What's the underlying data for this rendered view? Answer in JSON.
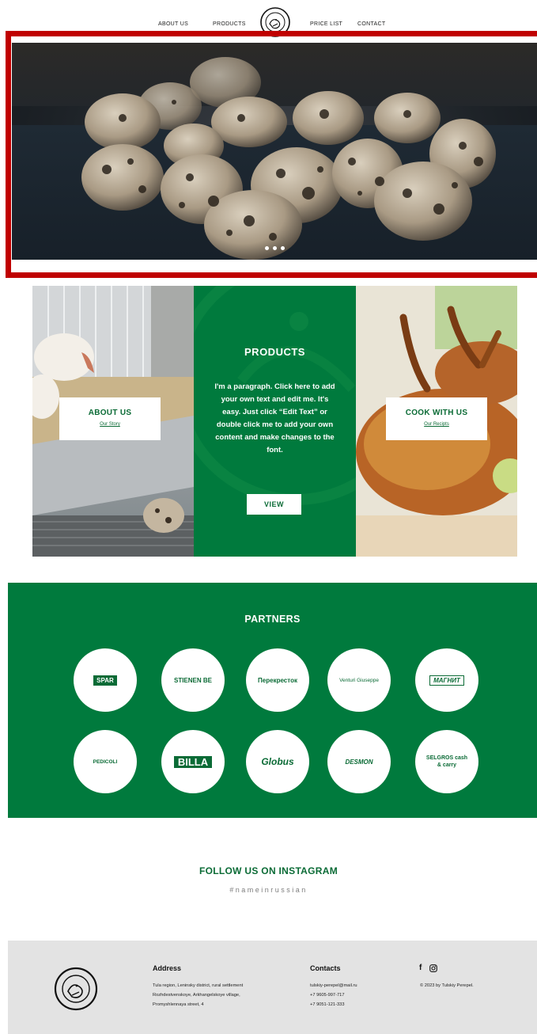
{
  "nav": {
    "items": [
      {
        "label": "ABOUT US"
      },
      {
        "label": "PRODUCTS"
      },
      {
        "label": "PRICE LIST"
      },
      {
        "label": "CONTACT"
      }
    ],
    "logo_icon": "quail-emblem-icon"
  },
  "hero": {
    "slide_count": 3,
    "image": "quail-eggs-photo"
  },
  "panels": {
    "about": {
      "title": "ABOUT US",
      "link": "Our Story"
    },
    "products": {
      "title": "PRODUCTS",
      "paragraph": "I'm a paragraph. Click here to add your own text and edit me. It's easy. Just click “Edit Text” or double click me to add your own content and make changes to the font.",
      "button": "VIEW"
    },
    "cook": {
      "title": "COOK WITH US",
      "link": "Our Recipts"
    }
  },
  "partners": {
    "title": "PARTNERS",
    "logos": [
      {
        "label": "SPAR"
      },
      {
        "label": "STIENEN BE"
      },
      {
        "label": "Перекресток"
      },
      {
        "label": "Venturi Giuseppe"
      },
      {
        "label": "МАГНИТ"
      },
      {
        "label": "PEDICOLI"
      },
      {
        "label": "BILLA"
      },
      {
        "label": "Globus"
      },
      {
        "label": "DESMON"
      },
      {
        "label": "SELGROS cash & carry"
      }
    ]
  },
  "instagram": {
    "title": "FOLLOW US ON INSTAGRAM",
    "hashtag": "#nameinrussian"
  },
  "footer": {
    "address_title": "Address",
    "address_lines": [
      "Tula region, Leninsky district, rural settlement",
      "Rozhdestvenskoye, Arkhangelskoye village,",
      "Promyshlennaya street, 4"
    ],
    "contacts_title": "Contacts",
    "contact_lines": [
      "tulskiy-perepel@mail.ru",
      "+7 9605-997-717",
      "+7 9051-121-333"
    ],
    "copyright": "© 2023 by Tulskiy Perepel.",
    "social": [
      "facebook-icon",
      "instagram-icon"
    ]
  },
  "colors": {
    "brand_green": "#007a3d",
    "hero_highlight": "#c00000",
    "footer_bg": "#e3e3e3"
  }
}
